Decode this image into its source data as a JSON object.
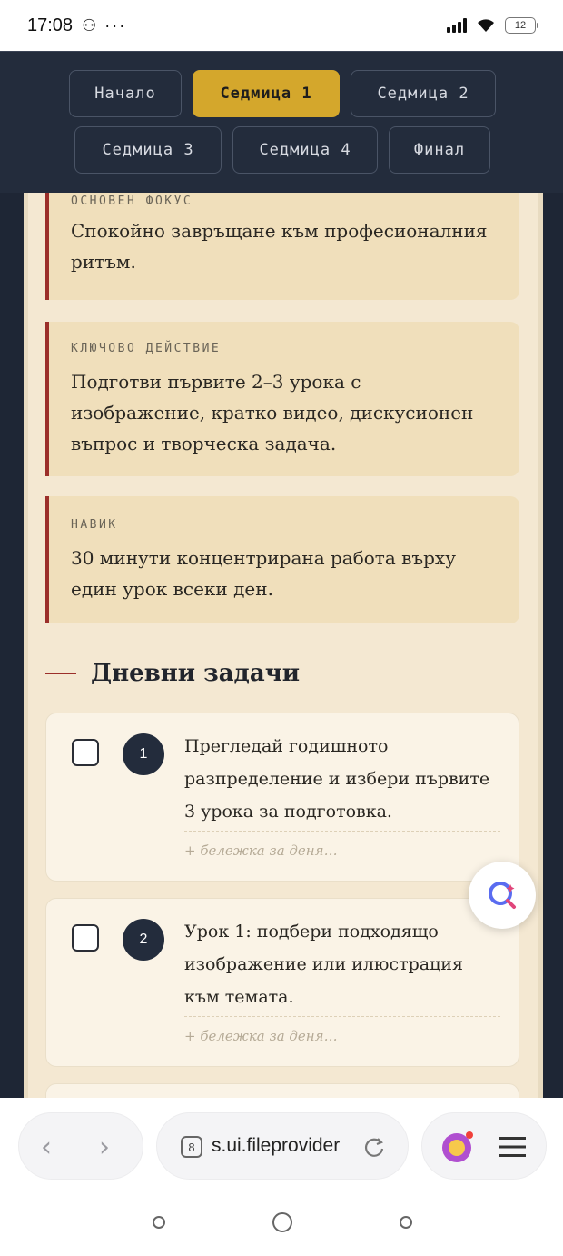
{
  "status_bar": {
    "time": "17:08",
    "left_icons": "⚇ ···",
    "battery": "12"
  },
  "nav": {
    "tabs": [
      {
        "label": "Начало",
        "active": false
      },
      {
        "label": "Седмица 1",
        "active": true
      },
      {
        "label": "Седмица 2",
        "active": false
      },
      {
        "label": "Седмица 3",
        "active": false
      },
      {
        "label": "Седмица 4",
        "active": false
      },
      {
        "label": "Финал",
        "active": false
      }
    ]
  },
  "cards": [
    {
      "label": "ОСНОВЕН ФОКУС",
      "text": "Спокойно завръщане към професионалния ритъм."
    },
    {
      "label": "КЛЮЧОВО ДЕЙСТВИЕ",
      "text": "Подготви първите 2–3 урока с изображение, кратко видео, дискусионен въпрос и творческа задача."
    },
    {
      "label": "НАВИК",
      "text": "30 минути концентрирана работа върху един урок всеки ден."
    }
  ],
  "daily": {
    "title": "Дневни задачи",
    "tasks": [
      {
        "number": "1",
        "text": "Прегледай годишното разпределение и избери първите 3 урока за подготовка.",
        "note_placeholder": "+ бележка за деня…",
        "checked": false
      },
      {
        "number": "2",
        "text": "Урок 1: подбери подходящо изображение или илюстрация към темата.",
        "note_placeholder": "+ бележка за деня…",
        "checked": false
      }
    ]
  },
  "browser": {
    "url": "s.ui.fileprovider",
    "tab_count": "8"
  },
  "colors": {
    "accent": "#d4a72c",
    "header": "#232c3c",
    "card_border": "#9b2f2a",
    "page_bg": "#f4e8d2"
  }
}
